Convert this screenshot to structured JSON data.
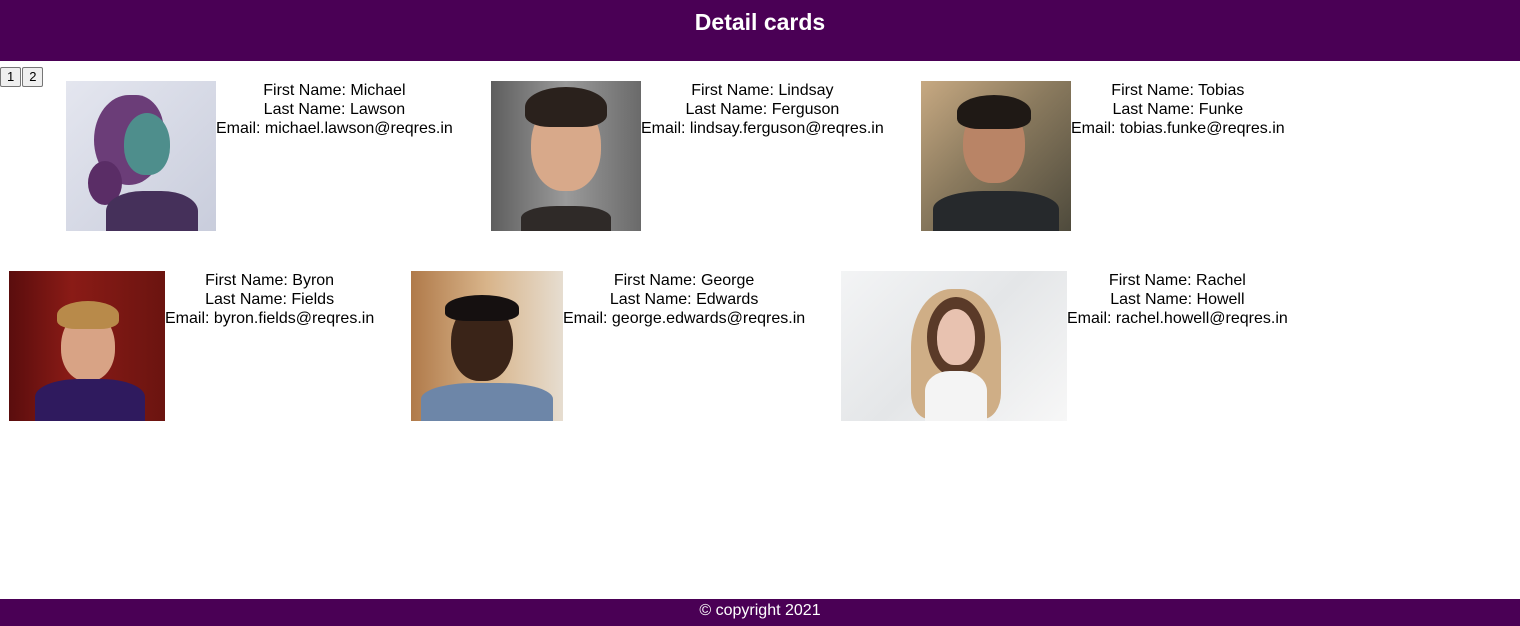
{
  "header": {
    "title": "Detail cards"
  },
  "pagination": {
    "pages": [
      "1",
      "2"
    ]
  },
  "labels": {
    "first_name": "First Name: ",
    "last_name": "Last Name: ",
    "email": "Email: "
  },
  "users": [
    {
      "first_name": "Michael",
      "last_name": "Lawson",
      "email": "michael.lawson@reqres.in",
      "avatar": "woman-profile-purple-light-photo"
    },
    {
      "first_name": "Lindsay",
      "last_name": "Ferguson",
      "email": "lindsay.ferguson@reqres.in",
      "avatar": "young-man-portrait-photo"
    },
    {
      "first_name": "Tobias",
      "last_name": "Funke",
      "email": "tobias.funke@reqres.in",
      "avatar": "smiling-man-outdoor-photo"
    },
    {
      "first_name": "Byron",
      "last_name": "Fields",
      "email": "byron.fields@reqres.in",
      "avatar": "man-red-wall-photo"
    },
    {
      "first_name": "George",
      "last_name": "Edwards",
      "email": "george.edwards@reqres.in",
      "avatar": "smiling-man-street-photo"
    },
    {
      "first_name": "Rachel",
      "last_name": "Howell",
      "email": "rachel.howell@reqres.in",
      "avatar": "woman-snow-hood-photo"
    }
  ],
  "footer": {
    "text": "© copyright 2021"
  },
  "colors": {
    "brand": "#4a0055",
    "background": "#ffffff"
  }
}
